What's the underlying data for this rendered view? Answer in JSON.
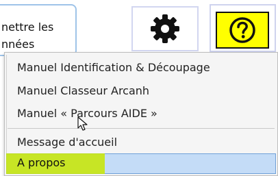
{
  "background_button": {
    "line1": "nettre les",
    "line2": "nnées"
  },
  "toolbar": {
    "settings_icon": "gear-icon",
    "help_icon": "question-circle-icon",
    "help_bg_color": "#ffff00"
  },
  "menu": {
    "items": [
      {
        "label": "Manuel Identification & Découpage"
      },
      {
        "label": "Manuel Classeur Arcanh"
      },
      {
        "label": "Manuel « Parcours AIDE »"
      },
      {
        "label": "Message d'accueil"
      },
      {
        "label": "A propos"
      }
    ],
    "selected_color": "#c4dcf7",
    "highlight_color": "#c8e600"
  }
}
